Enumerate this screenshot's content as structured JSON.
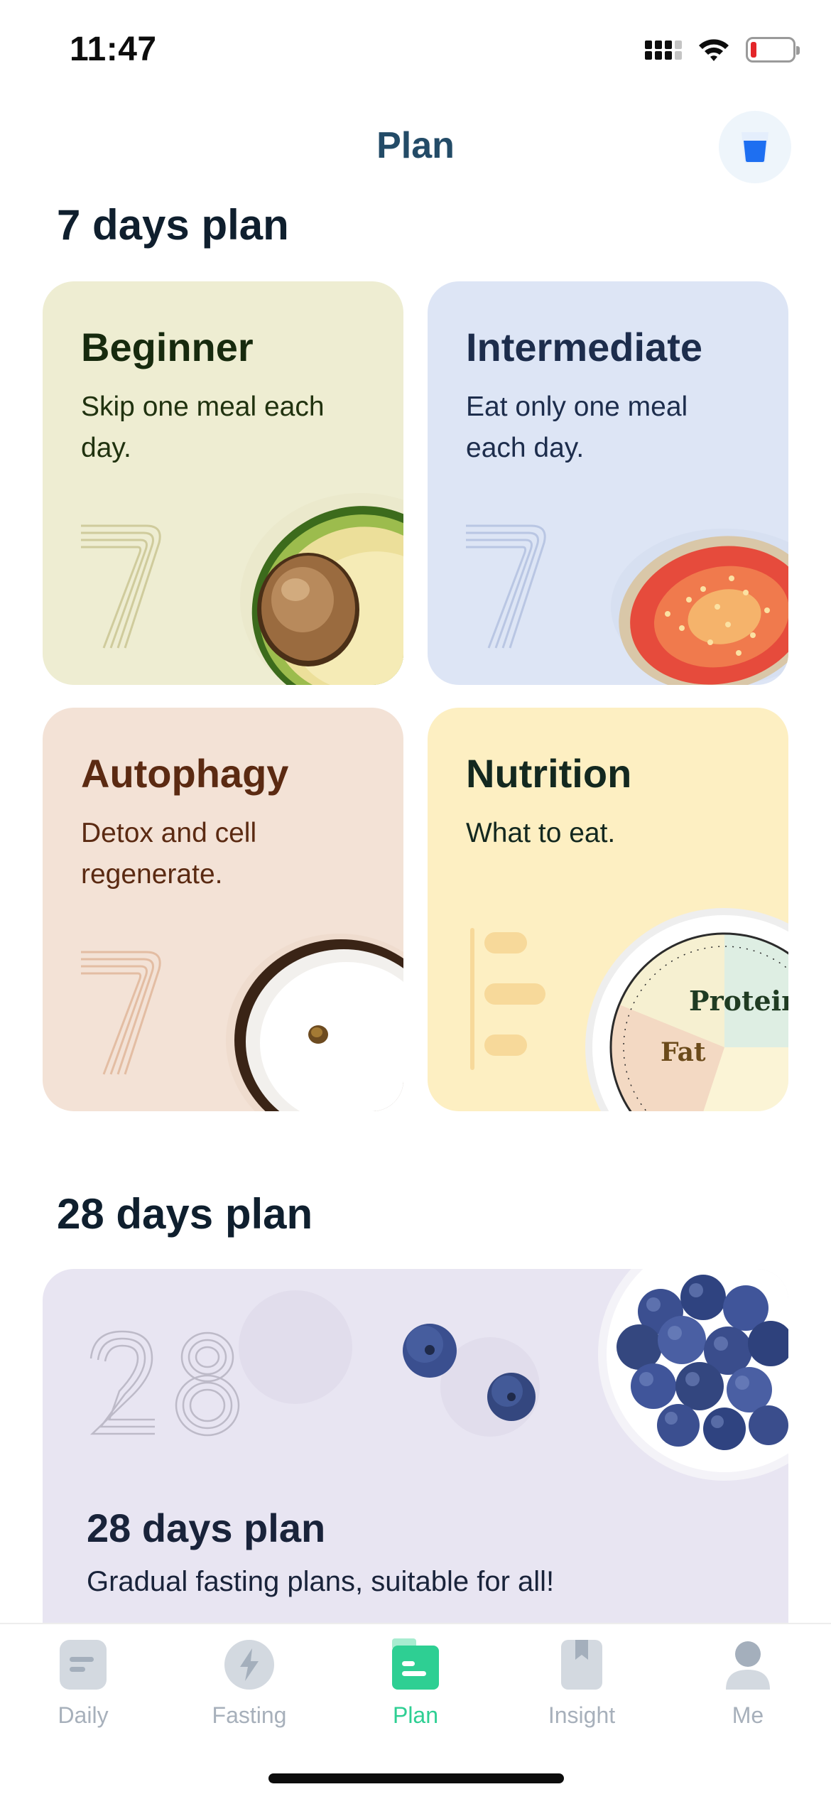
{
  "status_bar": {
    "time": "11:47"
  },
  "header": {
    "title": "Plan"
  },
  "section_7": {
    "title": "7 days plan",
    "cards": [
      {
        "title": "Beginner",
        "description": "Skip one meal each day.",
        "number": "7"
      },
      {
        "title": "Intermediate",
        "description": "Eat only one meal each day.",
        "number": "7"
      },
      {
        "title": "Autophagy",
        "description": "Detox and cell regenerate.",
        "number": "7"
      },
      {
        "title": "Nutrition",
        "description": "What to eat."
      }
    ]
  },
  "nutrition_plate": {
    "protein_label": "Protein",
    "fat_label": "Fat"
  },
  "section_28": {
    "title": "28 days plan",
    "card": {
      "number": "28",
      "title": "28 days plan",
      "description": "Gradual fasting plans, suitable for all!"
    }
  },
  "tab_bar": {
    "tabs": [
      {
        "label": "Daily",
        "icon": "daily-icon"
      },
      {
        "label": "Fasting",
        "icon": "lightning-icon"
      },
      {
        "label": "Plan",
        "icon": "plan-icon",
        "active": true
      },
      {
        "label": "Insight",
        "icon": "bookmark-icon"
      },
      {
        "label": "Me",
        "icon": "profile-icon"
      }
    ]
  },
  "colors": {
    "accent": "#2ecf93",
    "title": "#234b67",
    "water": "#1e6ff1"
  }
}
